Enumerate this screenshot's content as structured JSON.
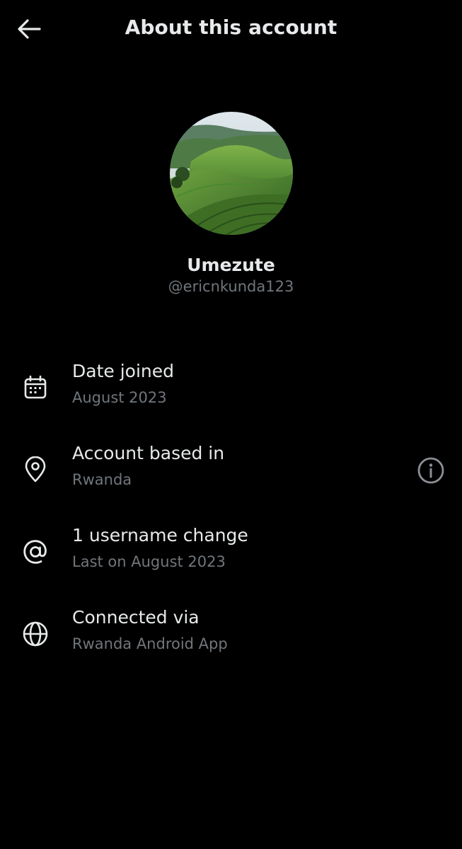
{
  "header": {
    "title": "About this account",
    "back_icon": "arrow-left-icon"
  },
  "profile": {
    "display_name": "Umezute",
    "handle": "@ericnkunda123",
    "avatar": "green-hills-landscape-photo"
  },
  "rows": [
    {
      "icon": "calendar-icon",
      "title": "Date joined",
      "subtitle": "August 2023"
    },
    {
      "icon": "location-pin-icon",
      "title": "Account based in",
      "subtitle": "Rwanda",
      "action_icon": "info-circle-icon"
    },
    {
      "icon": "at-sign-icon",
      "title": "1 username change",
      "subtitle": "Last on August 2023"
    },
    {
      "icon": "globe-icon",
      "title": "Connected via",
      "subtitle": "Rwanda Android App"
    }
  ],
  "colors": {
    "background": "#000000",
    "primary_text": "#e7e9ea",
    "secondary_text": "#71767b"
  }
}
